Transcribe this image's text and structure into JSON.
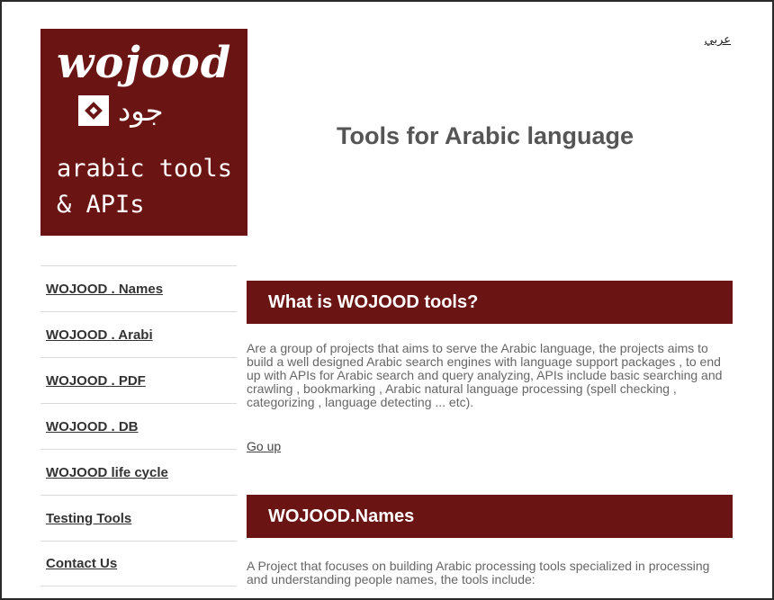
{
  "header": {
    "lang_switch": "عربي",
    "title": "Tools for Arabic language"
  },
  "logo": {
    "brand": "wojood",
    "arabic": "جود",
    "tagline_line1": "arabic tools",
    "tagline_line2": "& APIs"
  },
  "sidebar": {
    "items": [
      {
        "label": "WOJOOD . Names"
      },
      {
        "label": "WOJOOD . Arabi"
      },
      {
        "label": "WOJOOD . PDF"
      },
      {
        "label": "WOJOOD . DB"
      },
      {
        "label": "WOJOOD life cycle"
      },
      {
        "label": "Testing Tools"
      },
      {
        "label": "Contact Us"
      }
    ]
  },
  "main": {
    "section1": {
      "heading": "What is WOJOOD tools?",
      "body": "Are a group of projects that aims to serve the Arabic language, the projects aims to build a well designed Arabic search engines with language support packages , to end up with APIs for Arabic search and query analyzing, APIs include basic searching and crawling , bookmarking , Arabic natural language processing (spell checking , categorizing , language detecting ... etc).",
      "go_up": "Go up"
    },
    "section2": {
      "heading": "WOJOOD.Names",
      "body": "A Project that focuses on building Arabic processing tools specialized in processing and understanding people names, the tools include:"
    }
  },
  "colors": {
    "brand": "#6b1414",
    "text": "#666666"
  }
}
